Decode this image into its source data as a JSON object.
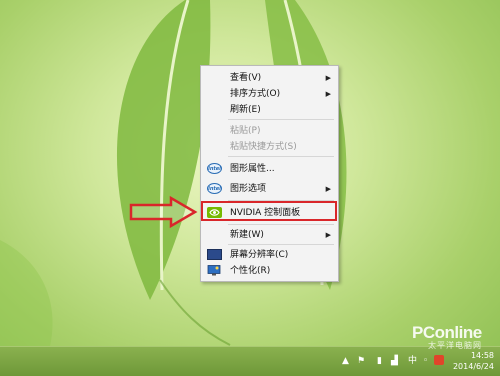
{
  "context_menu": {
    "items": [
      {
        "label": "查看(V)",
        "has_submenu": true,
        "enabled": true
      },
      {
        "label": "排序方式(O)",
        "has_submenu": true,
        "enabled": true
      },
      {
        "label": "刷新(E)",
        "has_submenu": false,
        "enabled": true
      },
      {
        "label": "粘贴(P)",
        "has_submenu": false,
        "enabled": false
      },
      {
        "label": "粘贴快捷方式(S)",
        "has_submenu": false,
        "enabled": false
      },
      {
        "label": "图形属性...",
        "icon": "intel-icon",
        "has_submenu": false,
        "enabled": true
      },
      {
        "label": "图形选项",
        "icon": "intel-icon",
        "has_submenu": true,
        "enabled": true
      },
      {
        "label": "NVIDIA 控制面板",
        "icon": "nvidia-icon",
        "has_submenu": false,
        "enabled": true,
        "highlighted": true
      },
      {
        "label": "新建(W)",
        "has_submenu": true,
        "enabled": true
      },
      {
        "label": "屏幕分辨率(C)",
        "icon": "monitor-icon",
        "has_submenu": false,
        "enabled": true
      },
      {
        "label": "个性化(R)",
        "icon": "personalize-icon",
        "has_submenu": false,
        "enabled": true
      }
    ],
    "submenu_arrow": "▶",
    "intel_icon_text": "intel"
  },
  "taskbar": {
    "ime": "中",
    "time": "14:58",
    "date": "2014/6/24"
  },
  "watermark": {
    "brand": "PConline",
    "sub": "太平洋电脑网"
  },
  "colors": {
    "highlight_border": "#d9262a",
    "arrow_outline": "#d9262a",
    "nvidia_green": "#76b900",
    "taskbar": "#7aa442"
  }
}
